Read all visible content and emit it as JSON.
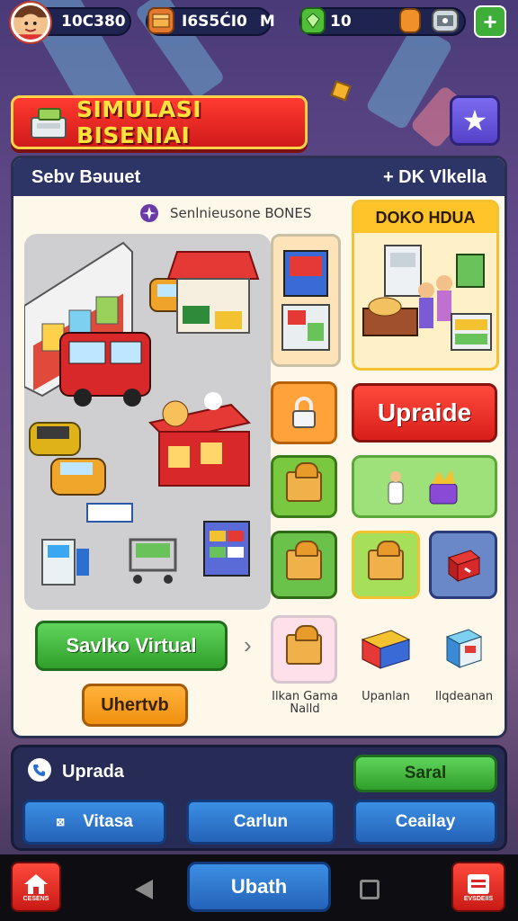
{
  "topbar": {
    "coins": "10C380",
    "cash": "I6S5ĆI0",
    "cash_suffix": "M",
    "gems": "10",
    "add_label": "+"
  },
  "title": "SIMULASI BISENIAI",
  "panel": {
    "header_left": "Sebv Bəuuet",
    "header_right": "+ DK Vlkella",
    "scene_caption": "Senlnieusone BONES",
    "doko_label": "DOKO HDUA",
    "upgrade_label": "Upraide",
    "virtual_label": "Savlko Virtual",
    "orange_label": "Uhertvb",
    "arrow_label": "›",
    "captions": [
      "Ilkan Gama Nalld",
      "Upanlan",
      "Ilqdeanan"
    ]
  },
  "bottom": {
    "title": "Uprada",
    "green_label": "Saral",
    "buttons": [
      "Vitasa",
      "Carlun",
      "Ceailay"
    ]
  },
  "navbar": {
    "center_label": "Ubath",
    "home_caption": "CESENS",
    "right_caption": "EVSDEIIS"
  },
  "colors": {
    "accent_red": "#e0241c",
    "accent_green": "#3bb236",
    "panel_dark": "#262c55",
    "title_yellow": "#ffe23b"
  }
}
